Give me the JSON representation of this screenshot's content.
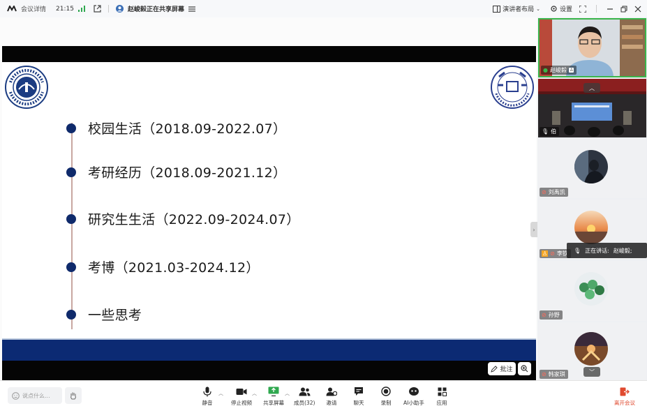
{
  "titlebar": {
    "meeting_details": "会议详情",
    "time": "21:15",
    "sharing_status": "赵峻毅正在共享屏幕",
    "layout_label": "演讲者布局",
    "settings_label": "设置"
  },
  "slide": {
    "items": [
      "校园生活（2018.09-2022.07）",
      "考研经历（2018.09-2021.12）",
      "研究生生活（2022.09-2024.07）",
      "考博（2021.03-2024.12）",
      "一些思考"
    ],
    "annotate_label": "批注"
  },
  "participants": [
    {
      "name": "赵峻毅"
    },
    {
      "name": "伯"
    },
    {
      "name": "刘禹凯"
    },
    {
      "name": "李钦"
    },
    {
      "name": "孙野"
    },
    {
      "name": "韩家琪"
    }
  ],
  "speaking": {
    "label": "正在讲话:",
    "name": "赵峻毅;"
  },
  "toolbar": {
    "chat_placeholder": "说点什么...",
    "mute": "静音",
    "stop_video": "停止视频",
    "share_screen": "共享屏幕",
    "members": "成员(32)",
    "invite": "邀请",
    "chat": "聊天",
    "record": "录制",
    "ai_assistant": "AI小助手",
    "apps": "应用",
    "leave": "离开会议"
  },
  "colors": {
    "slide_blue": "#0c2a73",
    "timeline_dot": "#0f2a6b",
    "leave_red": "#e04a2f",
    "active_speaker_border": "#39b54a"
  }
}
